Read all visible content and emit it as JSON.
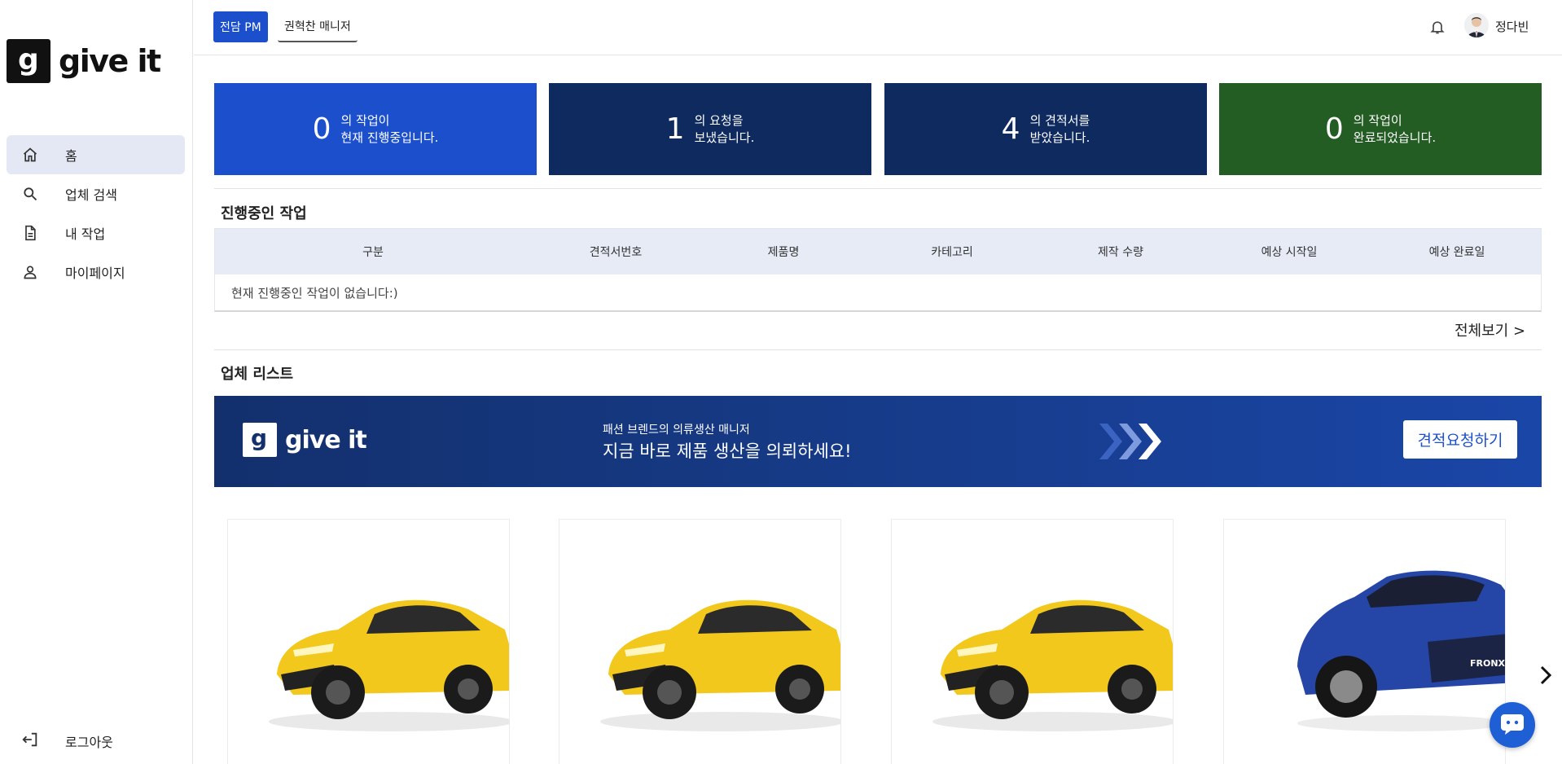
{
  "brand": {
    "name": "give it",
    "mark": "g"
  },
  "sidebar": {
    "items": [
      {
        "label": "홈",
        "icon": "home-icon",
        "active": true
      },
      {
        "label": "업체 검색",
        "icon": "search-icon",
        "active": false
      },
      {
        "label": "내 작업",
        "icon": "document-icon",
        "active": false
      },
      {
        "label": "마이페이지",
        "icon": "person-icon",
        "active": false
      }
    ],
    "logout_label": "로그아웃"
  },
  "header": {
    "pm_badge": "전담 PM",
    "manager_label": "권혁찬 매니저",
    "username": "정다빈"
  },
  "stats": [
    {
      "num": "0",
      "line1": "의 작업이",
      "line2": "현재 진행중입니다.",
      "color": "#1b4fcc"
    },
    {
      "num": "1",
      "line1": "의 요청을",
      "line2": "보냈습니다.",
      "color": "#0f2a5f"
    },
    {
      "num": "4",
      "line1": "의 견적서를",
      "line2": "받았습니다.",
      "color": "#0f2a5f"
    },
    {
      "num": "0",
      "line1": "의 작업이",
      "line2": "완료되었습니다.",
      "color": "#235d24"
    }
  ],
  "in_progress": {
    "title": "진행중인 작업",
    "columns": [
      "구분",
      "견적서번호",
      "제품명",
      "카테고리",
      "제작 수량",
      "예상 시작일",
      "예상 완료일"
    ],
    "empty_message": "현재 진행중인 작업이 없습니다:)",
    "view_all": "전체보기 >"
  },
  "vendors": {
    "title": "업체 리스트",
    "banner": {
      "subtitle": "패션 브렌드의 의류생산 매니저",
      "headline": "지금 바로 제품 생산을 의뢰하세요!",
      "button": "견적요청하기"
    },
    "cards": [
      {
        "image": "yellow-suv",
        "color": "#f2c81c"
      },
      {
        "image": "yellow-suv",
        "color": "#f2c81c"
      },
      {
        "image": "yellow-suv",
        "color": "#f2c81c"
      },
      {
        "image": "blue-suv",
        "color": "#2546a6",
        "grille_text": "FRONX"
      }
    ]
  },
  "colors": {
    "accent": "#1b4fcc",
    "navy": "#0f2a5f",
    "green": "#235d24"
  }
}
